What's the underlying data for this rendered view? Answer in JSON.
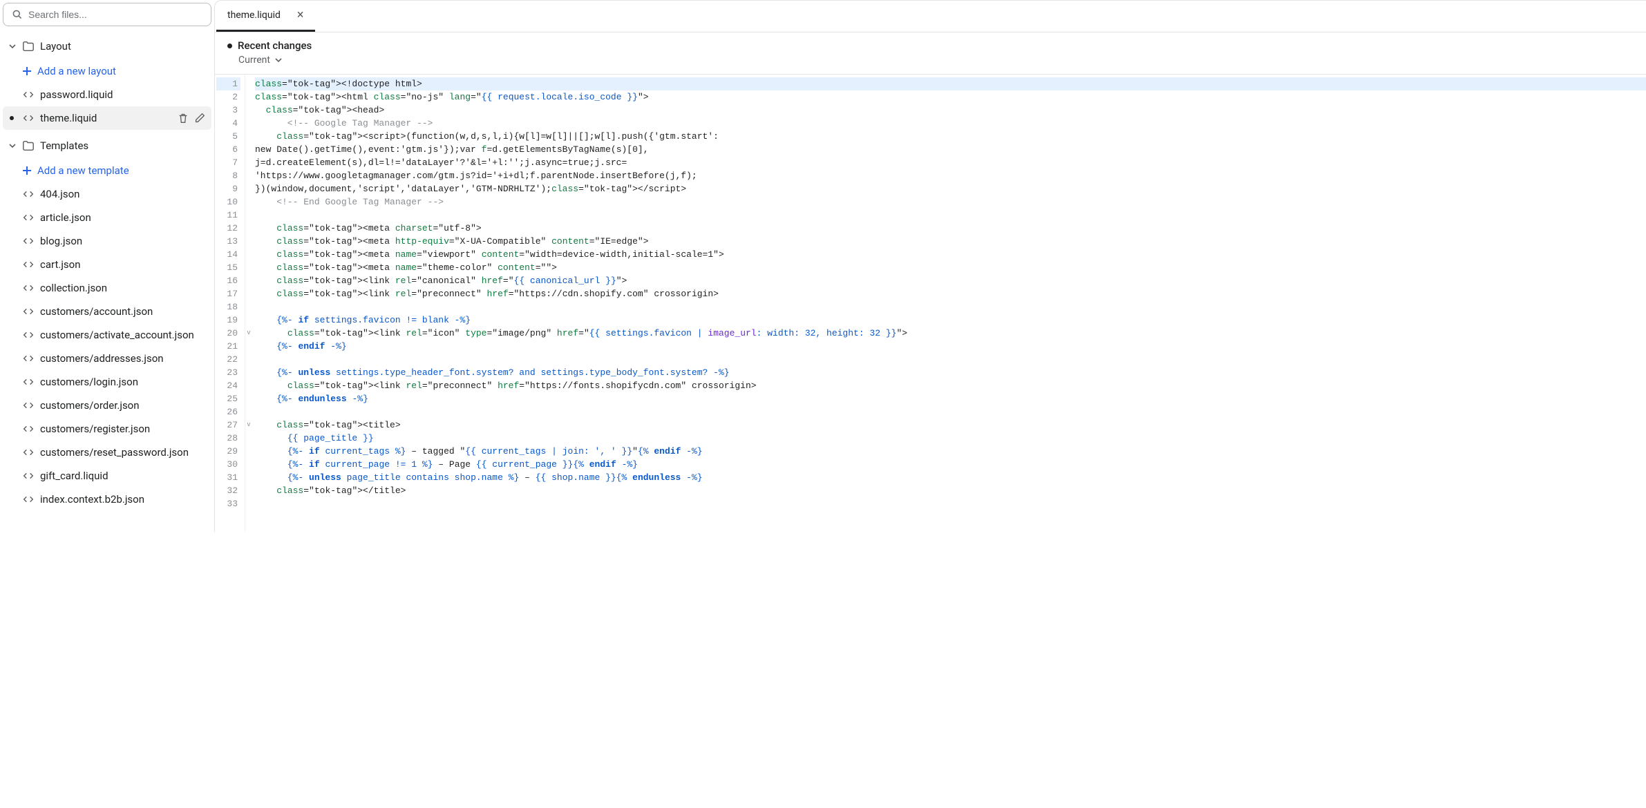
{
  "search": {
    "placeholder": "Search files..."
  },
  "sidebar": {
    "sections": [
      {
        "name": "Layout",
        "add_label": "Add a new layout",
        "files": [
          {
            "name": "password.liquid",
            "active": false,
            "dirty": false
          },
          {
            "name": "theme.liquid",
            "active": true,
            "dirty": true
          }
        ]
      },
      {
        "name": "Templates",
        "add_label": "Add a new template",
        "files": [
          {
            "name": "404.json"
          },
          {
            "name": "article.json"
          },
          {
            "name": "blog.json"
          },
          {
            "name": "cart.json"
          },
          {
            "name": "collection.json"
          },
          {
            "name": "customers/account.json"
          },
          {
            "name": "customers/activate_account.json"
          },
          {
            "name": "customers/addresses.json"
          },
          {
            "name": "customers/login.json"
          },
          {
            "name": "customers/order.json"
          },
          {
            "name": "customers/register.json"
          },
          {
            "name": "customers/reset_password.json"
          },
          {
            "name": "gift_card.liquid"
          },
          {
            "name": "index.context.b2b.json"
          }
        ]
      }
    ]
  },
  "tabs": [
    {
      "label": "theme.liquid",
      "active": true,
      "dirty": true
    }
  ],
  "subheader": {
    "recent_changes": "Recent changes",
    "current": "Current"
  },
  "code_lines": [
    "<!doctype html>",
    "<html class=\"no-js\" lang=\"{{ request.locale.iso_code }}\">",
    "  <head>",
    "      <!-- Google Tag Manager -->",
    "    <script>(function(w,d,s,l,i){w[l]=w[l]||[];w[l].push({'gtm.start':",
    "new Date().getTime(),event:'gtm.js'});var f=d.getElementsByTagName(s)[0],",
    "j=d.createElement(s),dl=l!='dataLayer'?'&l='+l:'';j.async=true;j.src=",
    "'https://www.googletagmanager.com/gtm.js?id='+i+dl;f.parentNode.insertBefore(j,f);",
    "})(window,document,'script','dataLayer','GTM-NDRHLTZ');</script>",
    "    <!-- End Google Tag Manager -->",
    "",
    "    <meta charset=\"utf-8\">",
    "    <meta http-equiv=\"X-UA-Compatible\" content=\"IE=edge\">",
    "    <meta name=\"viewport\" content=\"width=device-width,initial-scale=1\">",
    "    <meta name=\"theme-color\" content=\"\">",
    "    <link rel=\"canonical\" href=\"{{ canonical_url }}\">",
    "    <link rel=\"preconnect\" href=\"https://cdn.shopify.com\" crossorigin>",
    "",
    "    {%- if settings.favicon != blank -%}",
    "      <link rel=\"icon\" type=\"image/png\" href=\"{{ settings.favicon | image_url: width: 32, height: 32 }}\">",
    "    {%- endif -%}",
    "",
    "    {%- unless settings.type_header_font.system? and settings.type_body_font.system? -%}",
    "      <link rel=\"preconnect\" href=\"https://fonts.shopifycdn.com\" crossorigin>",
    "    {%- endunless -%}",
    "",
    "    <title>",
    "      {{ page_title }}",
    "      {%- if current_tags %} &ndash; tagged \"{{ current_tags | join: ', ' }}\"{% endif -%}",
    "      {%- if current_page != 1 %} &ndash; Page {{ current_page }}{% endif -%}",
    "      {%- unless page_title contains shop.name %} &ndash; {{ shop.name }}{% endunless -%}",
    "    </title>",
    ""
  ],
  "fold_markers": {
    "20": "v",
    "27": "v"
  },
  "highlighted_line": 1
}
